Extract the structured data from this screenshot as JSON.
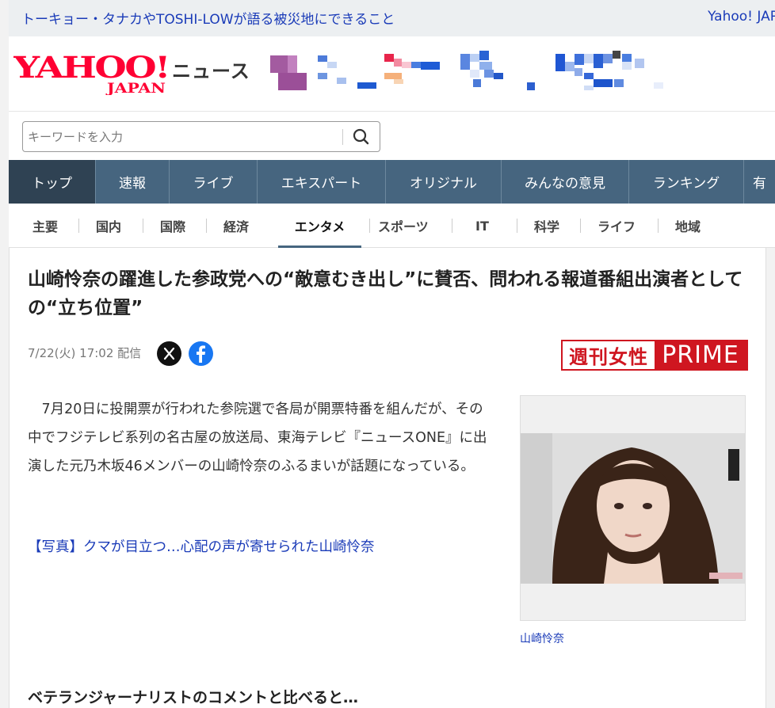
{
  "topbar": {
    "headline_link": "トーキョー・タナカやTOSHI-LOWが語る被災地にできること",
    "yahoo_japan_link": "Yahoo! JAP"
  },
  "header": {
    "logo_main": "YAHOO!",
    "logo_sub": "JAPAN",
    "service_name": "ニュース"
  },
  "search": {
    "placeholder": "キーワードを入力",
    "icon": "search-icon"
  },
  "global_nav": [
    {
      "label": "トップ",
      "active": true
    },
    {
      "label": "速報"
    },
    {
      "label": "ライブ"
    },
    {
      "label": "エキスパート"
    },
    {
      "label": "オリジナル"
    },
    {
      "label": "みんなの意見"
    },
    {
      "label": "ランキング"
    },
    {
      "label": "有"
    }
  ],
  "sub_nav": [
    {
      "label": "主要"
    },
    {
      "label": "国内"
    },
    {
      "label": "国際"
    },
    {
      "label": "経済"
    },
    {
      "label": "エンタメ",
      "active": true
    },
    {
      "label": "スポーツ"
    },
    {
      "label": "IT"
    },
    {
      "label": "科学"
    },
    {
      "label": "ライフ"
    },
    {
      "label": "地域"
    }
  ],
  "article": {
    "title": "山崎怜奈の躍進した参政党への“敵意むき出し”に賛否、問われる報道番組出演者としての“立ち位置”",
    "meta": "7/22(火) 17:02 配信",
    "share_icons": [
      "x-icon",
      "facebook-icon"
    ],
    "publisher_jp": "週刊女性",
    "publisher_en": "PRIME",
    "body": "7月20日に投開票が行われた参院選で各局が開票特番を組んだが、その中でフジテレビ系列の名古屋の放送局、東海テレビ『ニュースONE』に出演した元乃木坂46メンバーの山崎怜奈のふるまいが話題になっている。",
    "photo_link": "【写真】クマが目立つ…心配の声が寄せられた山崎怜奈",
    "photo_caption": "山崎怜奈",
    "subheading": "ベテランジャーナリストのコメントと比べると…"
  },
  "colors": {
    "link": "#1a3bb8",
    "nav_bg": "#46657f",
    "nav_active": "#2f4253",
    "publisher_red": "#cf1620",
    "yahoo_red": "#ff0033"
  }
}
